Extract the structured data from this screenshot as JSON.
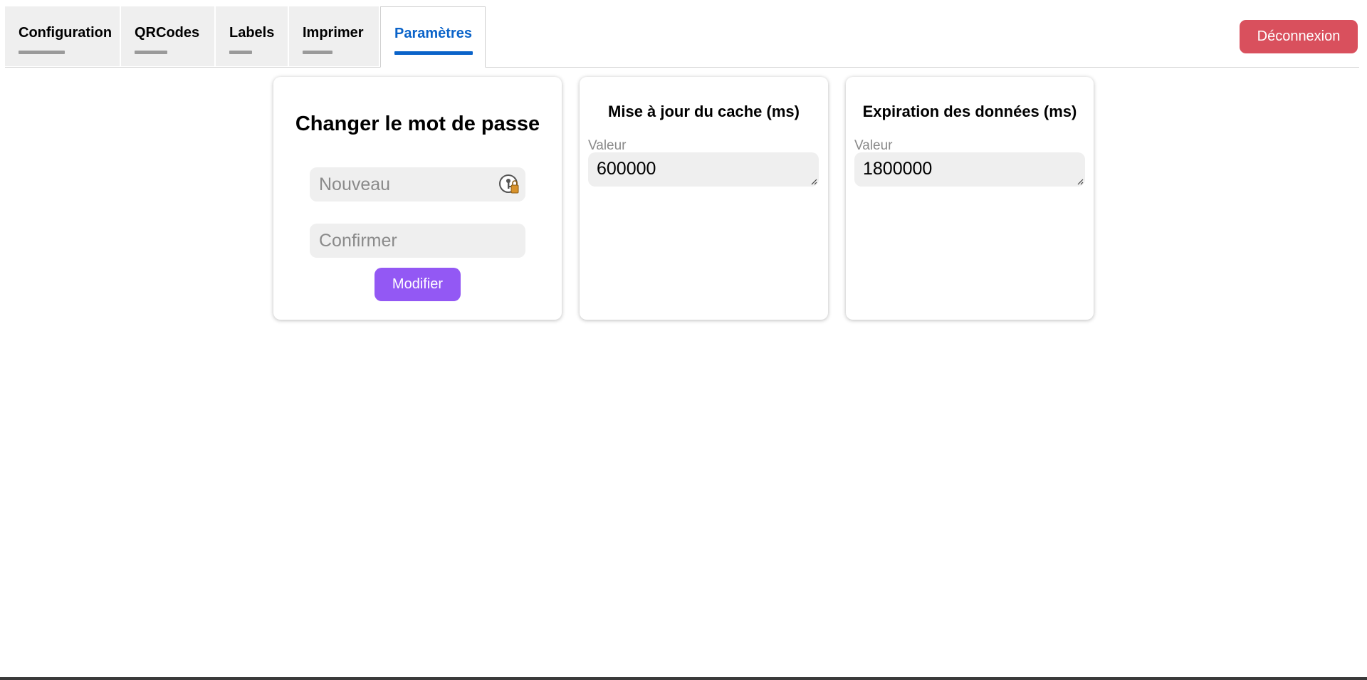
{
  "tabs": [
    {
      "label": "Configuration",
      "active": false
    },
    {
      "label": "QRCodes",
      "active": false
    },
    {
      "label": "Labels",
      "active": false
    },
    {
      "label": "Imprimer",
      "active": false
    },
    {
      "label": "Paramètres",
      "active": true
    }
  ],
  "header": {
    "logout_label": "Déconnexion"
  },
  "password_card": {
    "title": "Changer le mot de passe",
    "new_placeholder": "Nouveau",
    "confirm_placeholder": "Confirmer",
    "submit_label": "Modifier"
  },
  "cache_card": {
    "title": "Mise à jour du cache (ms)",
    "field_label": "Valeur",
    "value": "600000"
  },
  "expire_card": {
    "title": "Expiration des données (ms)",
    "field_label": "Valeur",
    "value": "1800000"
  },
  "colors": {
    "active_tab": "#0a63c9",
    "logout_button": "#d9505d",
    "submit_button": "#9358f4",
    "field_background": "#efefef"
  },
  "icons": [
    "password-manager-key-icon",
    "resize-grip-icon"
  ]
}
